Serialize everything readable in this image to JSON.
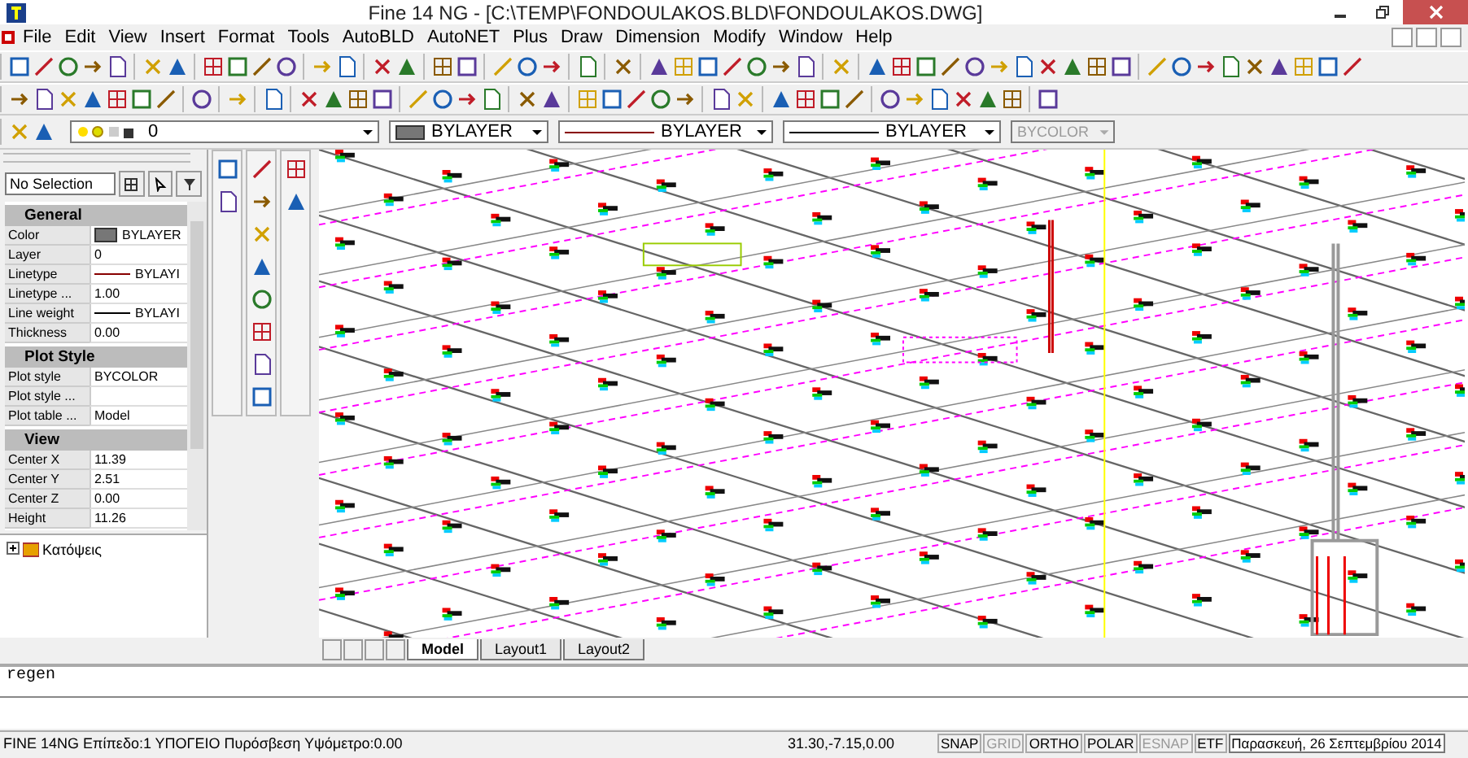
{
  "window": {
    "title": "Fine 14 NG  - [C:\\TEMP\\FONDOULAKOS.BLD\\FONDOULAKOS.DWG]"
  },
  "menu": [
    "File",
    "Edit",
    "View",
    "Insert",
    "Format",
    "Tools",
    "AutoBLD",
    "AutoNET",
    "Plus",
    "Draw",
    "Dimension",
    "Modify",
    "Window",
    "Help"
  ],
  "layer_bar": {
    "layer": "0",
    "color_setting": "BYLAYER",
    "linetype": "BYLAYER",
    "lineweight": "BYLAYER",
    "plot_style": {
      "value": "BYCOLOR",
      "disabled": true
    }
  },
  "properties": {
    "selection": "No Selection",
    "sections": [
      {
        "title": "General",
        "rows": [
          {
            "name": "Color",
            "value": "BYLAYER",
            "kind": "swatch"
          },
          {
            "name": "Layer",
            "value": "0",
            "kind": "text"
          },
          {
            "name": "Linetype",
            "value": "BYLAYI",
            "kind": "linetype"
          },
          {
            "name": "Linetype ...",
            "value": "1.00",
            "kind": "text"
          },
          {
            "name": "Line weight",
            "value": "BYLAYI",
            "kind": "lineweight"
          },
          {
            "name": "Thickness",
            "value": "0.00",
            "kind": "text"
          }
        ]
      },
      {
        "title": "Plot Style",
        "rows": [
          {
            "name": "Plot style",
            "value": "BYCOLOR",
            "kind": "text"
          },
          {
            "name": "Plot style ...",
            "kind": "text"
          },
          {
            "name": "Plot table ...",
            "value": "Model",
            "kind": "text"
          }
        ]
      },
      {
        "title": "View",
        "rows": [
          {
            "name": "Center X",
            "value": "11.39",
            "kind": "text"
          },
          {
            "name": "Center Y",
            "value": "2.51",
            "kind": "text"
          },
          {
            "name": "Center Z",
            "value": "0.00",
            "kind": "text"
          },
          {
            "name": "Height",
            "value": "11.26",
            "kind": "text"
          }
        ]
      }
    ]
  },
  "tree": [
    {
      "label": "Κατόψεις",
      "expanded": false
    }
  ],
  "layout_tabs": [
    {
      "label": "Model",
      "selected": true
    },
    {
      "label": "Layout1",
      "selected": false
    },
    {
      "label": "Layout2",
      "selected": false
    }
  ],
  "command": {
    "history": "regen"
  },
  "status_bar": {
    "info": "FINE 14NG Επίπεδο:1 ΥΠΟΓΕΙΟ Πυρόσβεση Υψόμετρο:0.00",
    "coordinates": "31.30,-7.15,0.00",
    "toggles": [
      {
        "label": "SNAP",
        "on": true
      },
      {
        "label": "GRID",
        "on": false
      },
      {
        "label": "ORTHO",
        "on": true
      },
      {
        "label": "POLAR",
        "on": true
      },
      {
        "label": "ESNAP",
        "on": false
      },
      {
        "label": "ETF",
        "on": true
      }
    ],
    "tooltip": "Παρασκευή, 26 Σεπτεμβρίου 2014"
  }
}
